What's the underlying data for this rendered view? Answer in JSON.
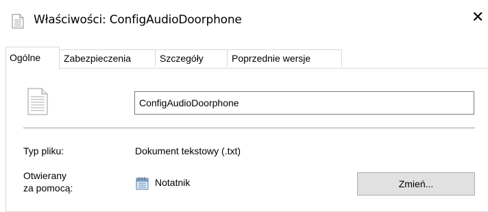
{
  "window": {
    "title": "Właściwości: ConfigAudioDoorphone",
    "close_glyph": "✕"
  },
  "tabs": [
    {
      "label": "Ogólne",
      "active": true
    },
    {
      "label": "Zabezpieczenia",
      "active": false
    },
    {
      "label": "Szczegóły",
      "active": false
    },
    {
      "label": "Poprzednie wersje",
      "active": false
    }
  ],
  "general": {
    "file_name": "ConfigAudioDoorphone",
    "file_type_label": "Typ pliku:",
    "file_type_value": "Dokument tekstowy (.txt)",
    "opens_with_label_line1": "Otwierany",
    "opens_with_label_line2": "za pomocą:",
    "opens_with_app": "Notatnik",
    "change_button_label": "Zmień..."
  },
  "icons": {
    "title": "text-document-icon",
    "file": "text-document-icon",
    "app": "notepad-icon"
  }
}
